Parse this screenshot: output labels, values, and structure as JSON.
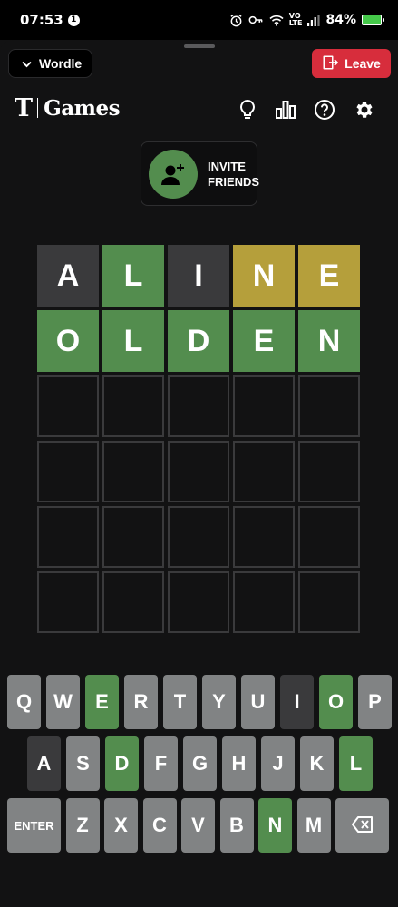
{
  "status_bar": {
    "time": "07:53",
    "notification_count": "1",
    "network_label_top": "VO",
    "network_label_bottom": "LTE",
    "battery_percent": "84%"
  },
  "sheet": {
    "game_selector_label": "Wordle",
    "leave_label": "Leave"
  },
  "header": {
    "logo_mark": "T",
    "logo_text": "Games"
  },
  "invite": {
    "line1": "INVITE",
    "line2": "FRIENDS"
  },
  "board": {
    "rows": [
      [
        {
          "letter": "A",
          "state": "absent"
        },
        {
          "letter": "L",
          "state": "correct"
        },
        {
          "letter": "I",
          "state": "absent"
        },
        {
          "letter": "N",
          "state": "present"
        },
        {
          "letter": "E",
          "state": "present"
        }
      ],
      [
        {
          "letter": "O",
          "state": "correct"
        },
        {
          "letter": "L",
          "state": "correct"
        },
        {
          "letter": "D",
          "state": "correct"
        },
        {
          "letter": "E",
          "state": "correct"
        },
        {
          "letter": "N",
          "state": "correct"
        }
      ],
      [
        {
          "letter": "",
          "state": "empty"
        },
        {
          "letter": "",
          "state": "empty"
        },
        {
          "letter": "",
          "state": "empty"
        },
        {
          "letter": "",
          "state": "empty"
        },
        {
          "letter": "",
          "state": "empty"
        }
      ],
      [
        {
          "letter": "",
          "state": "empty"
        },
        {
          "letter": "",
          "state": "empty"
        },
        {
          "letter": "",
          "state": "empty"
        },
        {
          "letter": "",
          "state": "empty"
        },
        {
          "letter": "",
          "state": "empty"
        }
      ],
      [
        {
          "letter": "",
          "state": "empty"
        },
        {
          "letter": "",
          "state": "empty"
        },
        {
          "letter": "",
          "state": "empty"
        },
        {
          "letter": "",
          "state": "empty"
        },
        {
          "letter": "",
          "state": "empty"
        }
      ],
      [
        {
          "letter": "",
          "state": "empty"
        },
        {
          "letter": "",
          "state": "empty"
        },
        {
          "letter": "",
          "state": "empty"
        },
        {
          "letter": "",
          "state": "empty"
        },
        {
          "letter": "",
          "state": "empty"
        }
      ]
    ]
  },
  "keyboard": {
    "rows": [
      [
        {
          "key": "Q",
          "state": "unused"
        },
        {
          "key": "W",
          "state": "unused"
        },
        {
          "key": "E",
          "state": "correct"
        },
        {
          "key": "R",
          "state": "unused"
        },
        {
          "key": "T",
          "state": "unused"
        },
        {
          "key": "Y",
          "state": "unused"
        },
        {
          "key": "U",
          "state": "unused"
        },
        {
          "key": "I",
          "state": "absent"
        },
        {
          "key": "O",
          "state": "correct"
        },
        {
          "key": "P",
          "state": "unused"
        }
      ],
      [
        {
          "key": "A",
          "state": "absent"
        },
        {
          "key": "S",
          "state": "unused"
        },
        {
          "key": "D",
          "state": "correct"
        },
        {
          "key": "F",
          "state": "unused"
        },
        {
          "key": "G",
          "state": "unused"
        },
        {
          "key": "H",
          "state": "unused"
        },
        {
          "key": "J",
          "state": "unused"
        },
        {
          "key": "K",
          "state": "unused"
        },
        {
          "key": "L",
          "state": "correct"
        }
      ],
      [
        {
          "key": "ENTER",
          "state": "unused"
        },
        {
          "key": "Z",
          "state": "unused"
        },
        {
          "key": "X",
          "state": "unused"
        },
        {
          "key": "C",
          "state": "unused"
        },
        {
          "key": "V",
          "state": "unused"
        },
        {
          "key": "B",
          "state": "unused"
        },
        {
          "key": "N",
          "state": "correct"
        },
        {
          "key": "M",
          "state": "unused"
        },
        {
          "key": "",
          "state": "unused",
          "icon": "backspace-icon"
        }
      ]
    ]
  },
  "colors": {
    "correct": "#538d4e",
    "present": "#b59f3b",
    "absent": "#3a3a3c",
    "unused_key": "#818384",
    "leave_button": "#d72d3c",
    "background": "#121213"
  }
}
